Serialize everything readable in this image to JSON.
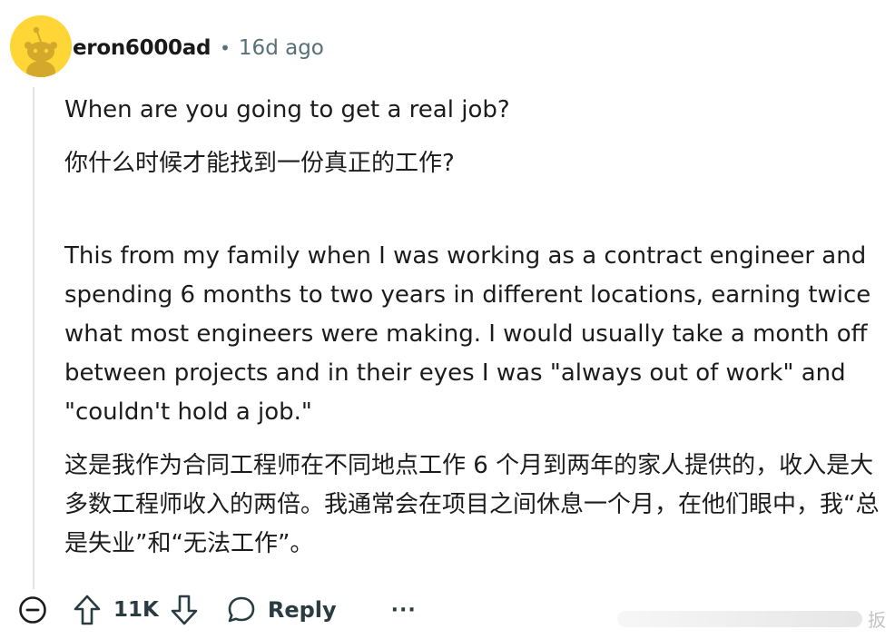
{
  "comment": {
    "author": "eron6000ad",
    "separator": "•",
    "age": "16d ago",
    "paragraphs": {
      "q_en": "When are you going to get a real job?",
      "q_zh": "你什么时候才能找到一份真正的工作?",
      "story_en": "This from my family when I was working as a contract engineer and spending 6 months to two years in different locations, earning twice what most engineers were making. I would usually take a month off between projects and in their eyes I was \"always out of work\" and \"couldn't hold a job.\"",
      "story_zh": "这是我作为合同工程师在不同地点工作 6 个月到两年的家人提供的，收入是大多数工程师收入的两倍。我通常会在项目之间休息一个月，在他们眼中，我“总是失业”和“无法工作”。"
    }
  },
  "actions": {
    "score": "11K",
    "reply_label": "Reply",
    "more_label": "···"
  },
  "watermark": {
    "text": "扳"
  },
  "icons": {
    "avatar": "snoo-avatar-icon",
    "collapse": "collapse-minus-icon",
    "upvote": "upvote-arrow-icon",
    "downvote": "downvote-arrow-icon",
    "reply": "speech-bubble-icon"
  },
  "colors": {
    "avatar_bg": "#ffd635",
    "meta_text": "#576f76",
    "thread_line": "#dfe4e8"
  }
}
